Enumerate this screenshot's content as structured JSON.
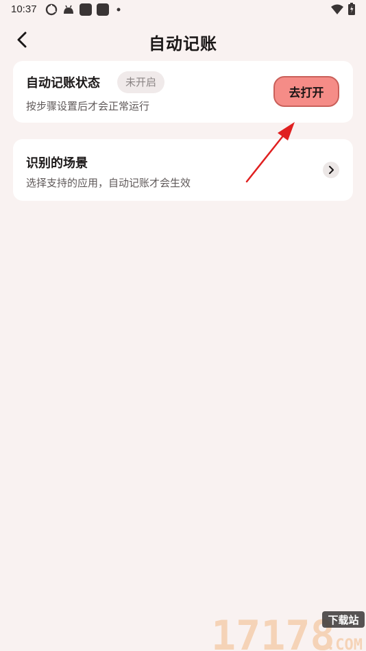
{
  "status_bar": {
    "time": "10:37",
    "icons": [
      "sync-icon",
      "android-icon",
      "app-badge-icon",
      "app-badge-icon",
      "dot-icon",
      "wifi-icon",
      "battery-icon"
    ]
  },
  "header": {
    "title": "自动记账",
    "back_icon": "chevron-left-icon"
  },
  "status_card": {
    "title": "自动记账状态",
    "badge": "未开启",
    "description": "按步骤设置后才会正常运行",
    "button_label": "去打开",
    "button_color": "#f58c87"
  },
  "scenes_card": {
    "title": "识别的场景",
    "description": "选择支持的应用，自动记账才会生效",
    "chevron_icon": "chevron-right-icon"
  },
  "annotation": {
    "color": "#e02020"
  },
  "watermark": {
    "number": "17178",
    "badge": "下载站",
    "suffix": ".COM"
  },
  "colors": {
    "background": "#f9f2f1",
    "card": "#ffffff",
    "accent": "#f58c87"
  }
}
